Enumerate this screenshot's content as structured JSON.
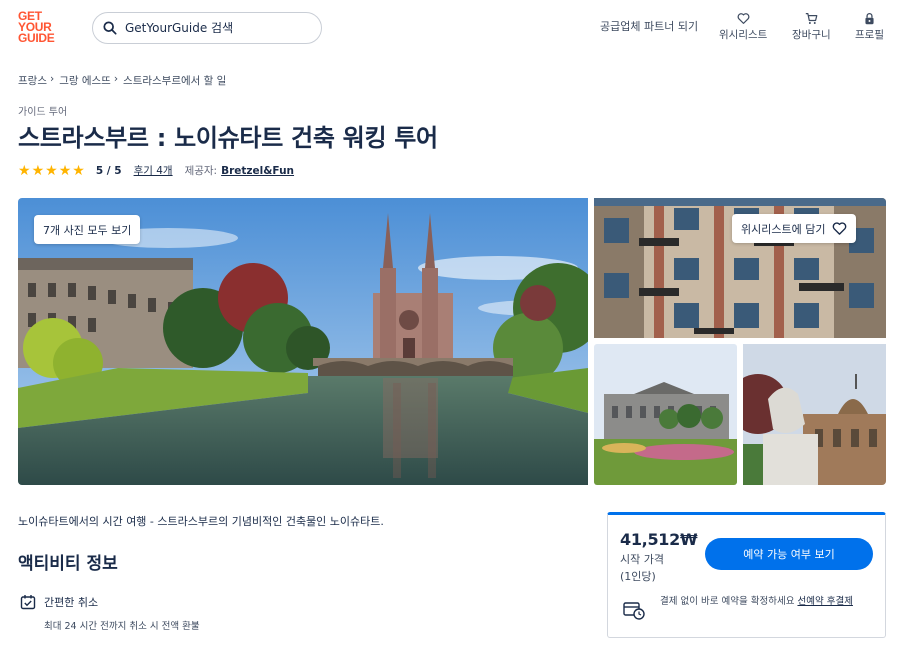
{
  "header": {
    "logo_lines": [
      "GET",
      "YOUR",
      "GUIDE"
    ],
    "search_placeholder": "GetYourGuide 검색",
    "partner_link": "공급업체 파트너 되기",
    "nav": {
      "wishlist": "위시리스트",
      "cart": "장바구니",
      "profile": "프로필"
    }
  },
  "breadcrumb": [
    "프랑스",
    "그랑 에스뜨",
    "스트라스부르에서 할 일"
  ],
  "breadcrumb_separator": "›",
  "category": "가이드 투어",
  "title": "스트라스부르 : 노이슈타트 건축 워킹 투어",
  "rating": {
    "stars": 5,
    "score_text": "5 / 5",
    "reviews": "후기 4개",
    "provider_label": "제공자:",
    "provider": "Bretzel&Fun"
  },
  "gallery": {
    "view_all_label": "7개 사진 모두 보기",
    "wishlist_label": "위시리스트에 담기"
  },
  "description": "노이슈타트에서의 시간 여행 - 스트라스부르의 기념비적인 건축물인 노이슈타트.",
  "activity_info": {
    "heading": "액티비티 정보",
    "feature_title": "간편한 취소",
    "feature_sub": "최대 24 시간 전까지 취소 시 전액 환불"
  },
  "booking": {
    "price": "41,512₩",
    "price_label": "시작 가격",
    "price_unit": "(1인당)",
    "check_button": "예약 가능 여부 보기",
    "note_text": "결제 없이 바로 예약을 확정하세요 ",
    "note_link": "선예약 후결제"
  },
  "colors": {
    "brand": "#ff5533",
    "primary": "#0071eb",
    "star": "#ffb400",
    "text": "#1a2b49"
  }
}
